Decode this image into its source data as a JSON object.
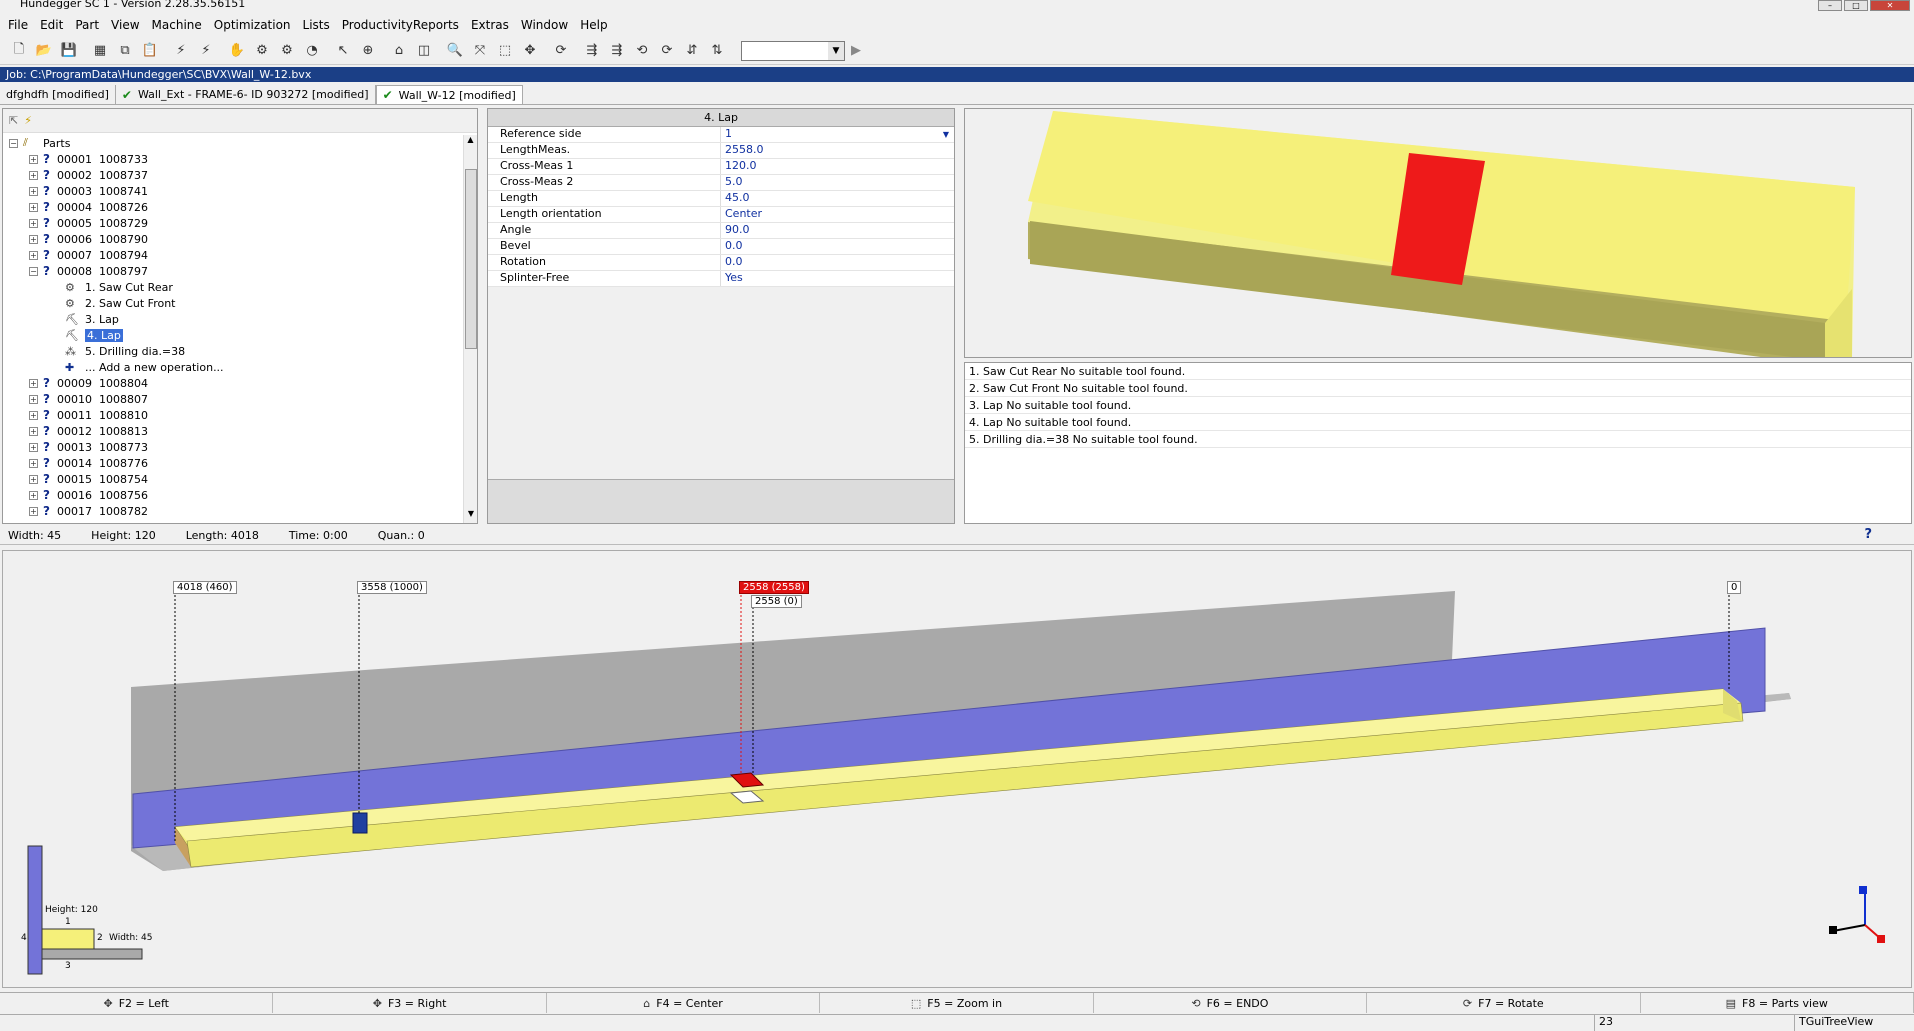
{
  "window": {
    "title": "Hundegger SC 1 - Version 2.28.35.56151"
  },
  "menu": [
    "File",
    "Edit",
    "Part",
    "View",
    "Machine",
    "Optimization",
    "Lists",
    "ProductivityReports",
    "Extras",
    "Window",
    "Help"
  ],
  "toolbar": {
    "icons": [
      "new-file-icon",
      "open-folder-icon",
      "save-icon",
      "layout-icon",
      "copy-icon",
      "paste-icon",
      "optimize-icon",
      "optimize-all-icon",
      "hand-icon",
      "settings-icon",
      "gear-icon",
      "gauge-icon",
      "pointer-icon",
      "cursor-icon",
      "home-icon",
      "box-icon",
      "zoom-icon",
      "zoom-fit-icon",
      "zoom-window-icon",
      "pan-icon",
      "rotate-icon",
      "view-a-icon",
      "view-b-icon",
      "view-c-icon",
      "view-d-icon",
      "view-e-icon",
      "view-f-icon",
      "play-icon"
    ],
    "combo_value": ""
  },
  "job": {
    "label": "Job: C:\\ProgramData\\Hundegger\\SC\\BVX\\Wall_W-12.bvx"
  },
  "tabs": [
    {
      "label": "dfghdfh [modified]",
      "checked": false
    },
    {
      "label": "Wall_Ext - FRAME-6- ID 903272 [modified]",
      "checked": true
    },
    {
      "label": "Wall_W-12 [modified]",
      "checked": true,
      "active": true
    }
  ],
  "tree": {
    "root": "Parts",
    "parts_before": [
      {
        "num": "00001",
        "id": "1008733"
      },
      {
        "num": "00002",
        "id": "1008737"
      },
      {
        "num": "00003",
        "id": "1008741"
      },
      {
        "num": "00004",
        "id": "1008726"
      },
      {
        "num": "00005",
        "id": "1008729"
      },
      {
        "num": "00006",
        "id": "1008790"
      },
      {
        "num": "00007",
        "id": "1008794"
      }
    ],
    "expanded_part": {
      "num": "00008",
      "id": "1008797"
    },
    "operations": [
      {
        "label": "1. Saw Cut Rear",
        "icon": "saw-icon"
      },
      {
        "label": "2. Saw Cut Front",
        "icon": "saw-icon"
      },
      {
        "label": "3. Lap",
        "icon": "lap-icon"
      },
      {
        "label": "4. Lap",
        "icon": "lap-icon",
        "selected": true
      },
      {
        "label": "5. Drilling dia.=38",
        "icon": "drill-icon"
      },
      {
        "label": "... Add a new operation...",
        "icon": "add-icon"
      }
    ],
    "parts_after": [
      {
        "num": "00009",
        "id": "1008804"
      },
      {
        "num": "00010",
        "id": "1008807"
      },
      {
        "num": "00011",
        "id": "1008810"
      },
      {
        "num": "00012",
        "id": "1008813"
      },
      {
        "num": "00013",
        "id": "1008773"
      },
      {
        "num": "00014",
        "id": "1008776"
      },
      {
        "num": "00015",
        "id": "1008754"
      },
      {
        "num": "00016",
        "id": "1008756"
      },
      {
        "num": "00017",
        "id": "1008782"
      }
    ]
  },
  "properties": {
    "title": "4. Lap",
    "rows": [
      {
        "name": "Reference side",
        "value": "1",
        "dropdown": true
      },
      {
        "name": "LengthMeas.",
        "value": "2558.0"
      },
      {
        "name": "Cross-Meas 1",
        "value": "120.0"
      },
      {
        "name": "Cross-Meas 2",
        "value": "5.0"
      },
      {
        "name": "Length",
        "value": "45.0"
      },
      {
        "name": "Length orientation",
        "value": "Center"
      },
      {
        "name": "Angle",
        "value": "90.0"
      },
      {
        "name": "Bevel",
        "value": "0.0"
      },
      {
        "name": "Rotation",
        "value": "0.0"
      },
      {
        "name": "Splinter-Free",
        "value": "Yes"
      }
    ]
  },
  "messages": [
    "1. Saw Cut Rear No suitable tool found.",
    "2. Saw Cut Front No suitable tool found.",
    "3. Lap No suitable tool found.",
    "4. Lap No suitable tool found.",
    "5. Drilling dia.=38 No suitable tool found."
  ],
  "dims": {
    "width": "Width: 45",
    "height": "Height: 120",
    "length": "Length: 4018",
    "time": "Time: 0:00",
    "quan": "Quan.: 0"
  },
  "bottom_view": {
    "labels": {
      "l1": "4018 (460)",
      "l2": "3558 (1000)",
      "l3": "2558 (2558)",
      "l4": "2558 (0)",
      "l5": "0"
    },
    "section": {
      "height": "Height:  120",
      "width": "Width:  45",
      "s1": "1",
      "s2": "2",
      "s3": "3",
      "s4": "4"
    },
    "colors": {
      "timber": "#f5f07a",
      "fence": "#7373d8",
      "lap": "#e01010",
      "base": "#a8a8a8"
    }
  },
  "fkeys": [
    {
      "label": "F2 = Left",
      "icon": "left-arrows-icon"
    },
    {
      "label": "F3 = Right",
      "icon": "right-arrows-icon"
    },
    {
      "label": "F4 = Center",
      "icon": "center-icon"
    },
    {
      "label": "F5 = Zoom in",
      "icon": "zoom-in-icon"
    },
    {
      "label": "F6 = ENDO",
      "icon": "endo-icon"
    },
    {
      "label": "F7 = Rotate",
      "icon": "rotate-icon"
    },
    {
      "label": "F8 = Parts view",
      "icon": "parts-view-icon"
    }
  ],
  "status": {
    "count": "23",
    "component": "TGuiTreeView"
  }
}
